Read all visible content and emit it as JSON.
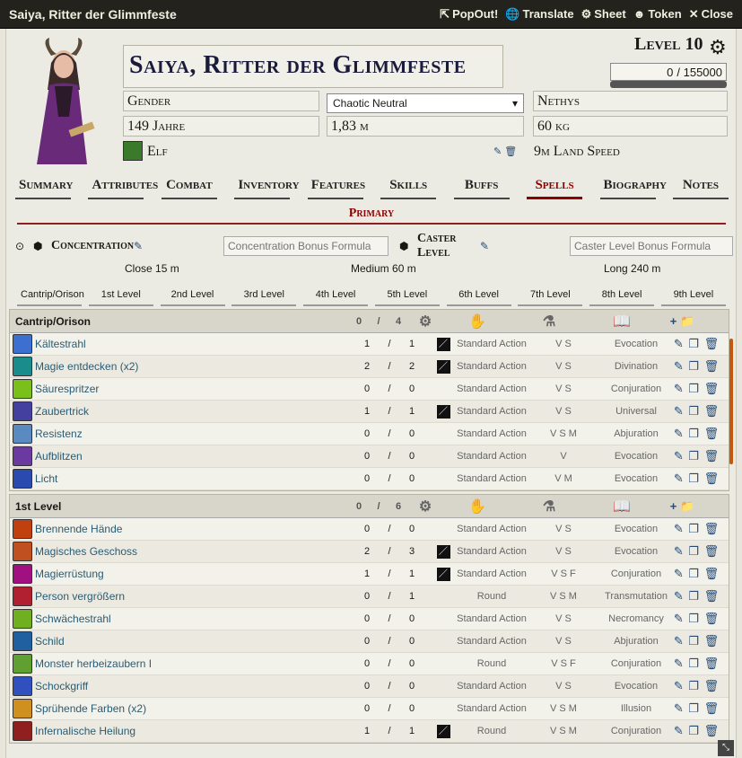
{
  "window": {
    "title": "Saiya, Ritter der Glimmfeste",
    "controls": [
      {
        "icon": "popout-icon",
        "label": "PopOut!"
      },
      {
        "icon": "translate-icon",
        "label": "Translate"
      },
      {
        "icon": "gear-icon",
        "label": "Sheet"
      },
      {
        "icon": "user-icon",
        "label": "Token"
      },
      {
        "icon": "close-icon",
        "label": "Close"
      }
    ]
  },
  "header": {
    "name": "Saiya, Ritter der Glimmfeste",
    "level": "Level 10",
    "xp": "0",
    "xp_max": "/ 155000",
    "gender": "Gender",
    "alignment": "Chaotic Neutral",
    "deity": "Nethys",
    "age": "149 Jahre",
    "height": "1,83 m",
    "weight": "60 kg",
    "race": "Elf",
    "speed": "9m Land Speed"
  },
  "tabs": [
    "Summary",
    "Attributes",
    "Combat",
    "Inventory",
    "Features",
    "Skills",
    "Buffs",
    "Spells",
    "Biography",
    "Notes"
  ],
  "active_tab": "Spells",
  "subtab": "Primary",
  "concentration": {
    "label": "Concentration",
    "placeholder": "Concentration Bonus Formula",
    "caster_label": "Caster Level",
    "caster_placeholder": "Caster Level Bonus Formula"
  },
  "ranges": {
    "close": "Close 15 m",
    "medium": "Medium 60 m",
    "long": "Long 240 m"
  },
  "level_tabs": [
    "Cantrip/Orison",
    "1st Level",
    "2nd Level",
    "3rd Level",
    "4th Level",
    "5th Level",
    "6th Level",
    "7th Level",
    "8th Level",
    "9th Level"
  ],
  "sections": [
    {
      "title": "Cantrip/Orison",
      "used": "0",
      "sep": "/",
      "max": "4",
      "spells": [
        {
          "name": "Kältestrahl",
          "u": "1",
          "m": "1",
          "chk": true,
          "act": "Standard Action",
          "comp": "V S",
          "school": "Evocation",
          "color": "#3b6fd0"
        },
        {
          "name": "Magie entdecken (x2)",
          "u": "2",
          "m": "2",
          "chk": true,
          "act": "Standard Action",
          "comp": "V S",
          "school": "Divination",
          "color": "#1a8c8c"
        },
        {
          "name": "Säurespritzer",
          "u": "0",
          "m": "0",
          "chk": false,
          "act": "Standard Action",
          "comp": "V S",
          "school": "Conjuration",
          "color": "#7abf1a"
        },
        {
          "name": "Zaubertrick",
          "u": "1",
          "m": "1",
          "chk": true,
          "act": "Standard Action",
          "comp": "V S",
          "school": "Universal",
          "color": "#4340a0"
        },
        {
          "name": "Resistenz",
          "u": "0",
          "m": "0",
          "chk": false,
          "act": "Standard Action",
          "comp": "V S M",
          "school": "Abjuration",
          "color": "#5a8ac0"
        },
        {
          "name": "Aufblitzen",
          "u": "0",
          "m": "0",
          "chk": false,
          "act": "Standard Action",
          "comp": "V",
          "school": "Evocation",
          "color": "#6a3aa0"
        },
        {
          "name": "Licht",
          "u": "0",
          "m": "0",
          "chk": false,
          "act": "Standard Action",
          "comp": "V M",
          "school": "Evocation",
          "color": "#2a4ab0"
        }
      ]
    },
    {
      "title": "1st Level",
      "used": "0",
      "sep": "/",
      "max": "6",
      "spells": [
        {
          "name": "Brennende Hände",
          "u": "0",
          "m": "0",
          "chk": false,
          "act": "Standard Action",
          "comp": "V S",
          "school": "Evocation",
          "color": "#c04010"
        },
        {
          "name": "Magisches Geschoss",
          "u": "2",
          "m": "3",
          "chk": true,
          "act": "Standard Action",
          "comp": "V S",
          "school": "Evocation",
          "color": "#c05020"
        },
        {
          "name": "Magierrüstung",
          "u": "1",
          "m": "1",
          "chk": true,
          "act": "Standard Action",
          "comp": "V S F",
          "school": "Conjuration",
          "color": "#a01080"
        },
        {
          "name": "Person vergrößern",
          "u": "0",
          "m": "1",
          "chk": false,
          "act": "Round",
          "comp": "V S M",
          "school": "Transmutation",
          "color": "#b02030"
        },
        {
          "name": "Schwächestrahl",
          "u": "0",
          "m": "0",
          "chk": false,
          "act": "Standard Action",
          "comp": "V S",
          "school": "Necromancy",
          "color": "#70b020"
        },
        {
          "name": "Schild",
          "u": "0",
          "m": "0",
          "chk": false,
          "act": "Standard Action",
          "comp": "V S",
          "school": "Abjuration",
          "color": "#2060a0"
        },
        {
          "name": "Monster herbeizaubern I",
          "u": "0",
          "m": "0",
          "chk": false,
          "act": "Round",
          "comp": "V S F",
          "school": "Conjuration",
          "color": "#60a030"
        },
        {
          "name": "Schockgriff",
          "u": "0",
          "m": "0",
          "chk": false,
          "act": "Standard Action",
          "comp": "V S",
          "school": "Evocation",
          "color": "#3050c0"
        },
        {
          "name": "Sprühende Farben (x2)",
          "u": "0",
          "m": "0",
          "chk": false,
          "act": "Standard Action",
          "comp": "V S M",
          "school": "Illusion",
          "color": "#d09020"
        },
        {
          "name": "Infernalische Heilung",
          "u": "1",
          "m": "1",
          "chk": true,
          "act": "Round",
          "comp": "V S M",
          "school": "Conjuration",
          "color": "#902020"
        }
      ]
    }
  ]
}
